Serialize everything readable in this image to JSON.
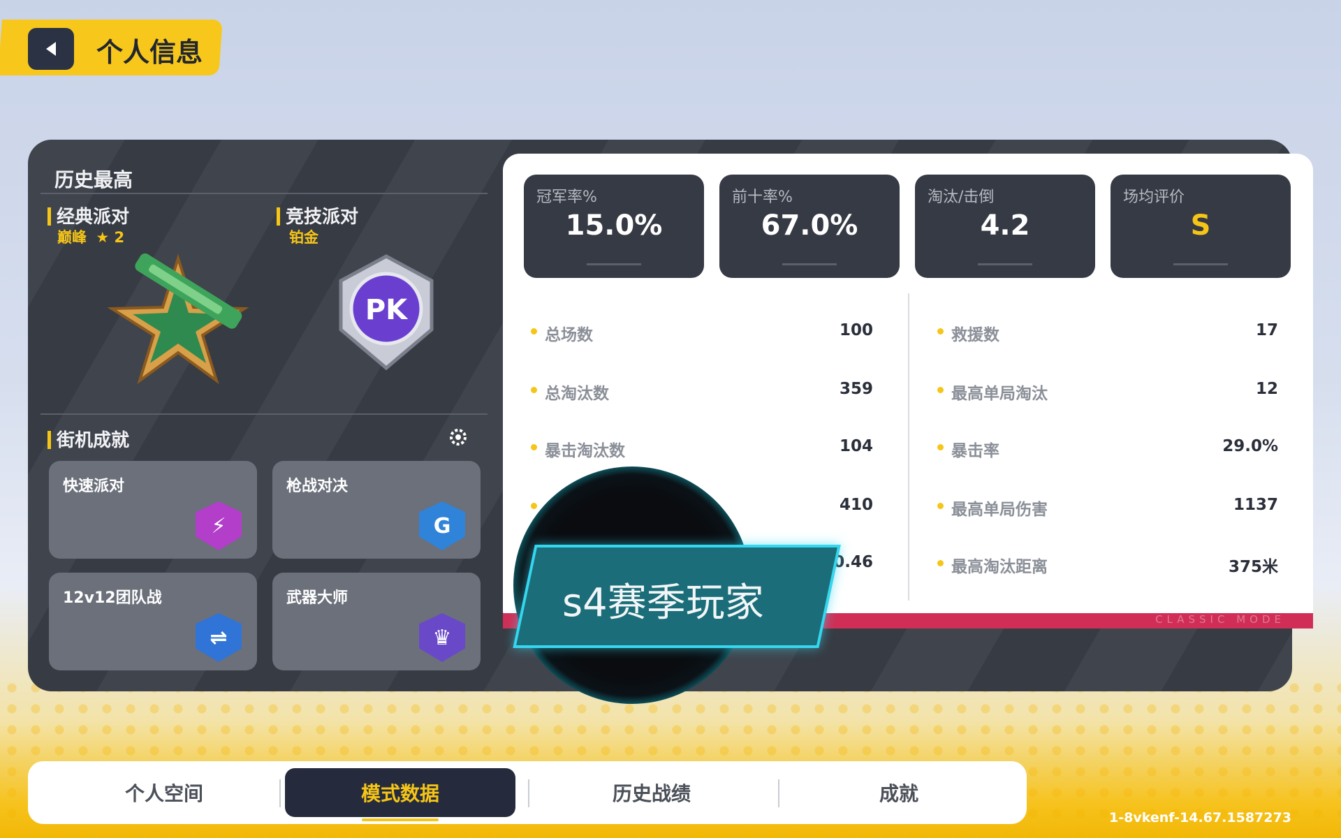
{
  "header": {
    "title": "个人信息",
    "back_icon": "back-arrow-icon"
  },
  "history": {
    "title": "历史最高",
    "modes": [
      {
        "name": "经典派对",
        "rank": "巅峰",
        "star_icon": "star-icon",
        "stars": "2"
      },
      {
        "name": "竞技派对",
        "rank": "铂金",
        "badge_text": "PK"
      }
    ]
  },
  "arcade": {
    "title": "街机成就",
    "settings_icon": "gear-icon",
    "tiles": [
      {
        "label": "快速派对",
        "color": "#b23ec9",
        "glyph": "⚡"
      },
      {
        "label": "枪战对决",
        "color": "#2f83d9",
        "glyph": "G"
      },
      {
        "label": "12v12团队战",
        "color": "#2f74d6",
        "glyph": "⇌"
      },
      {
        "label": "武器大师",
        "color": "#6a49c9",
        "glyph": "♛"
      }
    ]
  },
  "stats": {
    "highlights": [
      {
        "label": "冠军率%",
        "value": "15.0%"
      },
      {
        "label": "前十率%",
        "value": "67.0%"
      },
      {
        "label": "淘汰/击倒",
        "value": "4.2"
      },
      {
        "label": "场均评价",
        "value": "S"
      }
    ],
    "left": [
      {
        "name": "总场数",
        "value": "100"
      },
      {
        "name": "总淘汰数",
        "value": "359"
      },
      {
        "name": "暴击淘汰数",
        "value": "104"
      },
      {
        "name": "",
        "value": "410"
      },
      {
        "name": "",
        "value": "0.46"
      }
    ],
    "right": [
      {
        "name": "救援数",
        "value": "17"
      },
      {
        "name": "最高单局淘汰",
        "value": "12"
      },
      {
        "name": "暴击率",
        "value": "29.0%"
      },
      {
        "name": "最高单局伤害",
        "value": "1137"
      },
      {
        "name": "最高淘汰距离",
        "value": "375米"
      }
    ],
    "strip_text": "CLASSIC MODE",
    "rating_color": "#f5c518"
  },
  "season_badge": {
    "text": "s4赛季玩家"
  },
  "tabs": [
    {
      "label": "个人空间",
      "active": false
    },
    {
      "label": "模式数据",
      "active": true
    },
    {
      "label": "历史战绩",
      "active": false
    },
    {
      "label": "成就",
      "active": false
    }
  ],
  "build_id": "1-8vkenf-14.67.1587273"
}
